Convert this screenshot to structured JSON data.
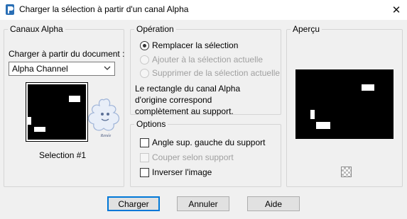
{
  "window": {
    "title": "Charger la sélection à partir d'un canal Alpha",
    "close_glyph": "✕"
  },
  "alpha_channels": {
    "group_title": "Canaux Alpha",
    "load_from_label": "Charger à partir du document :",
    "document_select": "Alpha Channel",
    "selection_name": "Selection #1",
    "watermark_text": "Renée"
  },
  "operation": {
    "group_title": "Opération",
    "options": [
      {
        "label": "Remplacer la sélection",
        "checked": true,
        "enabled": true
      },
      {
        "label": "Ajouter à la sélection actuelle",
        "checked": false,
        "enabled": false
      },
      {
        "label": "Supprimer de la sélection actuelle",
        "checked": false,
        "enabled": false
      }
    ],
    "info_lines": [
      "Le rectangle du canal Alpha",
      "d'origine correspond",
      "complètement au support."
    ]
  },
  "options": {
    "group_title": "Options",
    "items": [
      {
        "label": "Angle sup. gauche du support",
        "checked": false,
        "enabled": true
      },
      {
        "label": "Couper selon support",
        "checked": false,
        "enabled": false
      },
      {
        "label": "Inverser l'image",
        "checked": false,
        "enabled": true
      }
    ]
  },
  "preview": {
    "group_title": "Aperçu",
    "checker_icon": "transparency-checker-icon"
  },
  "buttons": {
    "load": "Charger",
    "cancel": "Annuler",
    "help": "Aide"
  },
  "colors": {
    "accent": "#0078d7",
    "dialog_bg": "#f0f0f0"
  }
}
